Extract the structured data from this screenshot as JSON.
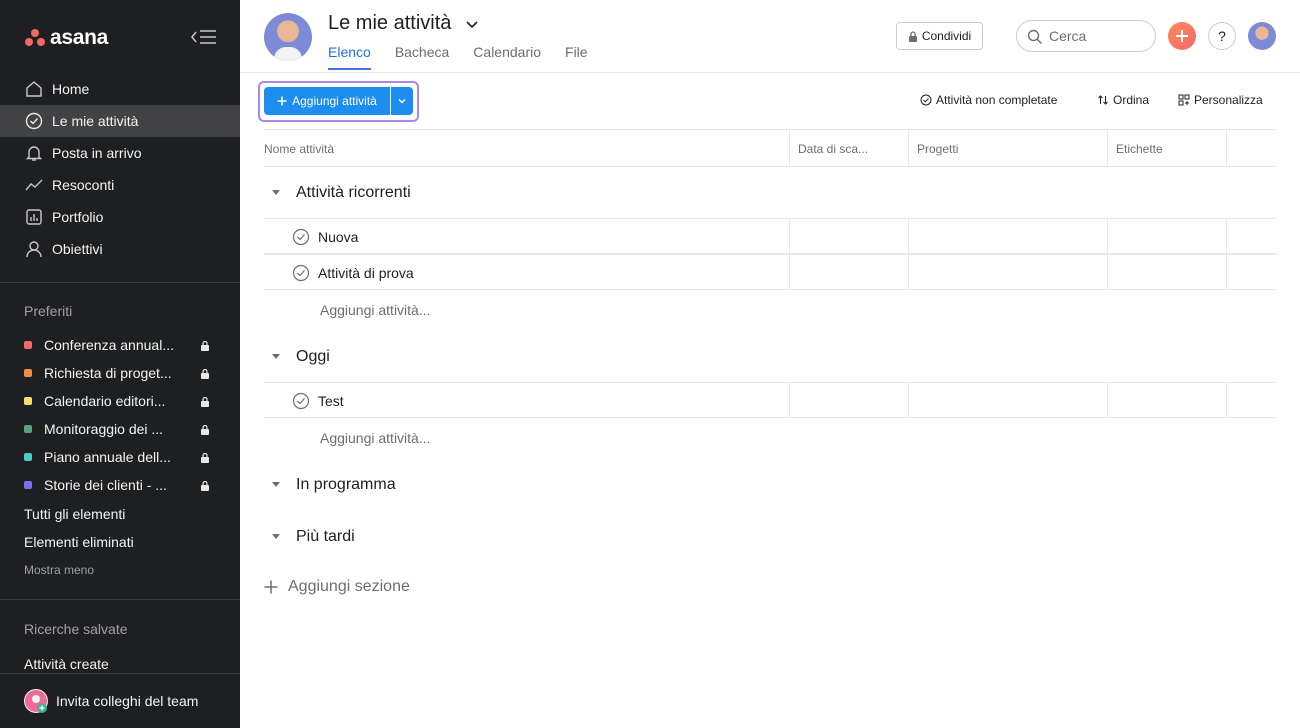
{
  "sidebar": {
    "logo_text": "asana",
    "nav": [
      {
        "label": "Home",
        "icon": "home-icon"
      },
      {
        "label": "Le mie attività",
        "icon": "check-circle-icon",
        "active": true
      },
      {
        "label": "Posta in arrivo",
        "icon": "bell-icon"
      },
      {
        "label": "Resoconti",
        "icon": "chart-line-icon"
      },
      {
        "label": "Portfolio",
        "icon": "bar-chart-icon"
      },
      {
        "label": "Obiettivi",
        "icon": "person-icon"
      }
    ],
    "favorites_label": "Preferiti",
    "favorites": [
      {
        "label": "Conferenza annual...",
        "color": "#f06a6a"
      },
      {
        "label": "Richiesta di proget...",
        "color": "#ec8d48"
      },
      {
        "label": "Calendario editori...",
        "color": "#f8df72"
      },
      {
        "label": "Monitoraggio dei ...",
        "color": "#5da283"
      },
      {
        "label": "Piano annuale dell...",
        "color": "#4ecbc4"
      },
      {
        "label": "Storie dei clienti - ...",
        "color": "#7a6ff0"
      }
    ],
    "all_items": "Tutti gli elementi",
    "deleted_items": "Elementi eliminati",
    "show_less": "Mostra meno",
    "saved_searches_label": "Ricerche salvate",
    "saved_search_item": "Attività create",
    "invite_label": "Invita colleghi del team"
  },
  "header": {
    "title": "Le mie attività",
    "tabs": [
      "Elenco",
      "Bacheca",
      "Calendario",
      "File"
    ],
    "active_tab": "Elenco",
    "share_label": "Condividi",
    "search_placeholder": "Cerca",
    "help_label": "?"
  },
  "toolbar": {
    "add_task_label": "Aggiungi attività",
    "filter_label": "Attività non completate",
    "sort_label": "Ordina",
    "customize_label": "Personalizza"
  },
  "table": {
    "columns": [
      "Nome attività",
      "Data di sca...",
      "Progetti",
      "Etichette"
    ],
    "sections": [
      {
        "title": "Attività ricorrenti",
        "tasks": [
          "Nuova",
          "Attività di prova"
        ],
        "add_label": "Aggiungi attività..."
      },
      {
        "title": "Oggi",
        "tasks": [
          "Test"
        ],
        "add_label": "Aggiungi attività..."
      },
      {
        "title": "In programma",
        "tasks": []
      },
      {
        "title": "Più tardi",
        "tasks": []
      }
    ],
    "add_section_label": "Aggiungi sezione"
  },
  "colors": {
    "sidebar_bg": "#1e1f21",
    "primary_button": "#1d8ef0",
    "highlight_border": "#a987ec",
    "active_tab": "#1d72d8"
  }
}
